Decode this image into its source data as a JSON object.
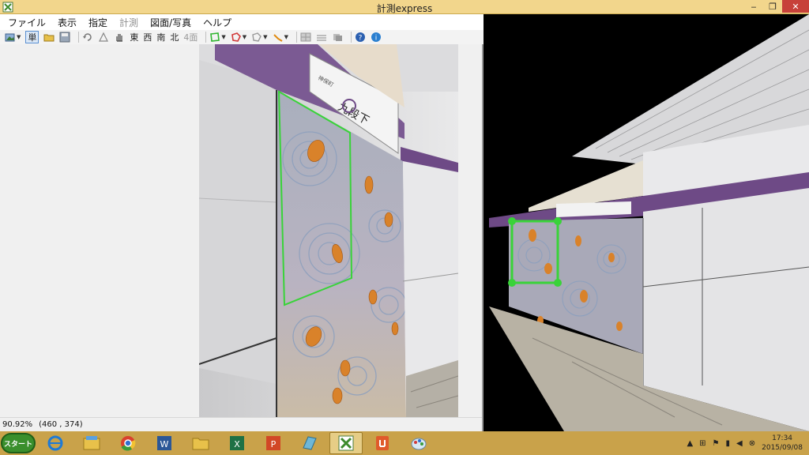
{
  "window": {
    "title": "計測express",
    "minimize": "‒",
    "maximize": "❐",
    "close": "✕"
  },
  "menu": {
    "items": [
      {
        "label": "ファイル",
        "enabled": true
      },
      {
        "label": "表示",
        "enabled": true
      },
      {
        "label": "指定",
        "enabled": true
      },
      {
        "label": "計測",
        "enabled": false
      },
      {
        "label": "図面/写真",
        "enabled": true
      },
      {
        "label": "ヘルプ",
        "enabled": true
      }
    ]
  },
  "toolbar": {
    "single_label": "単",
    "east_label": "東",
    "west_label": "西",
    "south_label": "南",
    "north_label": "北",
    "four_face_label": "4面"
  },
  "status": {
    "zoom": "90.92%",
    "coords": "(460 , 374)"
  },
  "photo_signs": {
    "station_name": "九段下",
    "station_code": "Z06",
    "station_kana": "神保町"
  },
  "taskbar": {
    "start_label": "スタート",
    "apps": [
      {
        "name": "internet-explorer",
        "active": false
      },
      {
        "name": "file-explorer",
        "active": false
      },
      {
        "name": "chrome",
        "active": false
      },
      {
        "name": "word",
        "active": false
      },
      {
        "name": "folder",
        "active": false
      },
      {
        "name": "excel",
        "active": false
      },
      {
        "name": "powerpoint",
        "active": false
      },
      {
        "name": "app-blue",
        "active": false
      },
      {
        "name": "keisoku-express",
        "active": true
      },
      {
        "name": "app-red",
        "active": false
      },
      {
        "name": "paint",
        "active": false
      }
    ],
    "time": "17:34",
    "date": "2015/09/08"
  },
  "colors": {
    "titlebar": "#f2d68c",
    "taskbar": "#c9a24a",
    "selection": "#39d339",
    "purple_band": "#6e4a86"
  }
}
